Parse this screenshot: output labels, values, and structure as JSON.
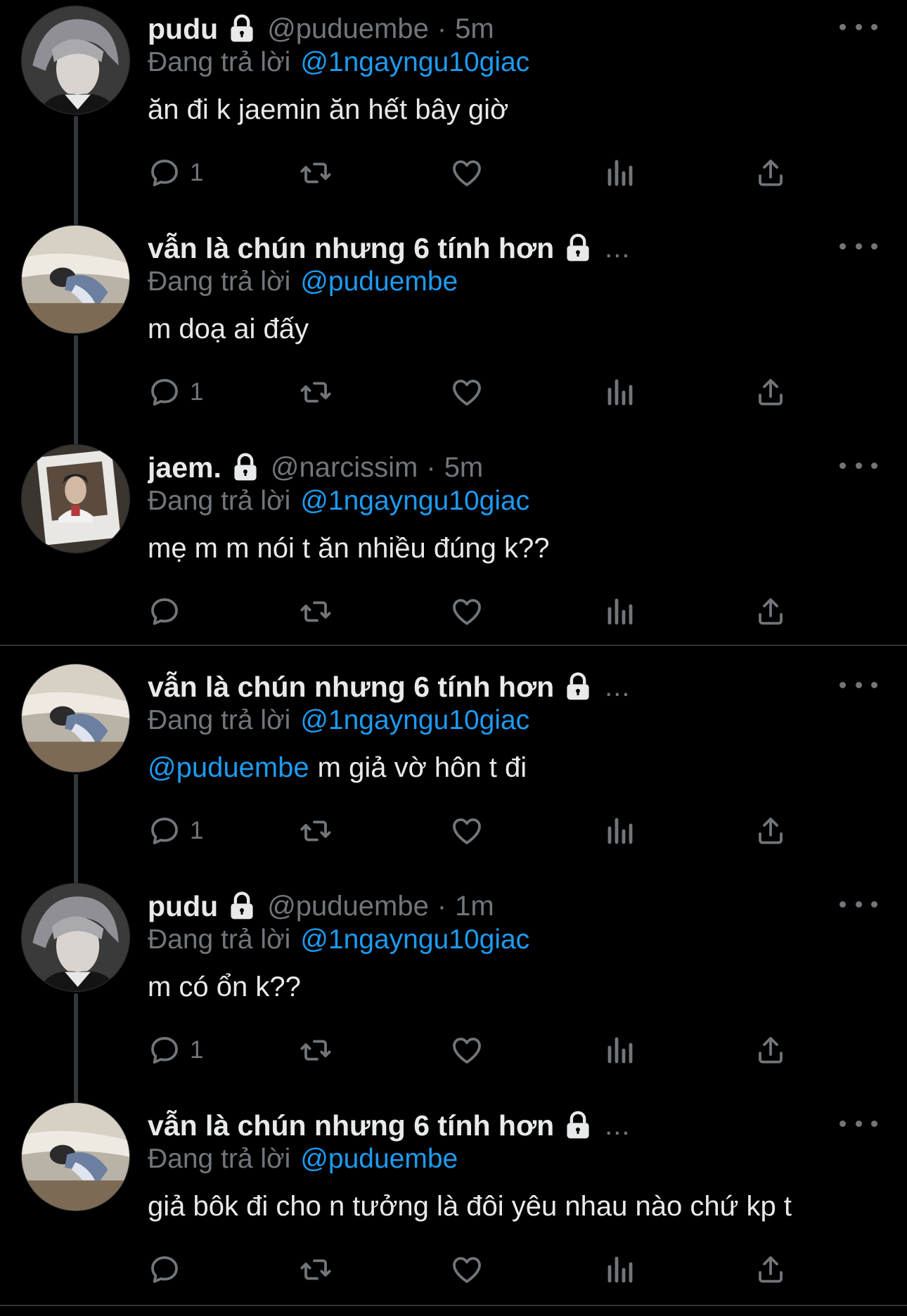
{
  "theme": {
    "background": "#000000",
    "text": "#e7e9ea",
    "muted": "#71767b",
    "link": "#1d9bf0",
    "thread_line": "#333639"
  },
  "tweets": [
    {
      "display_name": "pudu",
      "handle": "@puduembe",
      "dot": "·",
      "time": "5m",
      "ellipsis": "",
      "protected": true,
      "reply_prefix": "Đang trả lời",
      "reply_to": "@1ngayngu10giac",
      "body_mention": "",
      "body": "ăn đi k jaemin ăn hết bây giờ",
      "reply_count": "1",
      "avatar": "avatar-pudu"
    },
    {
      "display_name": "vẫn là chún nhưng 6 tính hơn",
      "handle": "",
      "dot": "",
      "time": "",
      "ellipsis": "...",
      "protected": true,
      "reply_prefix": "Đang trả lời",
      "reply_to": "@puduembe",
      "body_mention": "",
      "body": "m doạ ai đấy",
      "reply_count": "1",
      "avatar": "avatar-chun"
    },
    {
      "display_name": "jaem.",
      "handle": "@narcissim",
      "dot": "·",
      "time": "5m",
      "ellipsis": "",
      "protected": true,
      "reply_prefix": "Đang trả lời",
      "reply_to": "@1ngayngu10giac",
      "body_mention": "",
      "body": "mẹ m m nói t ăn nhiều đúng k??",
      "reply_count": "",
      "avatar": "avatar-jaem"
    },
    {
      "display_name": "vẫn là chún nhưng 6 tính hơn",
      "handle": "",
      "dot": "",
      "time": "",
      "ellipsis": "...",
      "protected": true,
      "reply_prefix": "Đang trả lời",
      "reply_to": "@1ngayngu10giac",
      "body_mention": "@puduembe",
      "body": "m giả vờ hôn t đi",
      "reply_count": "1",
      "avatar": "avatar-chun"
    },
    {
      "display_name": "pudu",
      "handle": "@puduembe",
      "dot": "·",
      "time": "1m",
      "ellipsis": "",
      "protected": true,
      "reply_prefix": "Đang trả lời",
      "reply_to": "@1ngayngu10giac",
      "body_mention": "",
      "body": "m có ổn k??",
      "reply_count": "1",
      "avatar": "avatar-pudu"
    },
    {
      "display_name": "vẫn là chún nhưng 6 tính hơn",
      "handle": "",
      "dot": "",
      "time": "",
      "ellipsis": "...",
      "protected": true,
      "reply_prefix": "Đang trả lời",
      "reply_to": "@puduembe",
      "body_mention": "",
      "body": "giả bôk đi cho n tưởng là đôi yêu nhau nào chứ kp t",
      "reply_count": "",
      "avatar": "avatar-chun"
    }
  ]
}
